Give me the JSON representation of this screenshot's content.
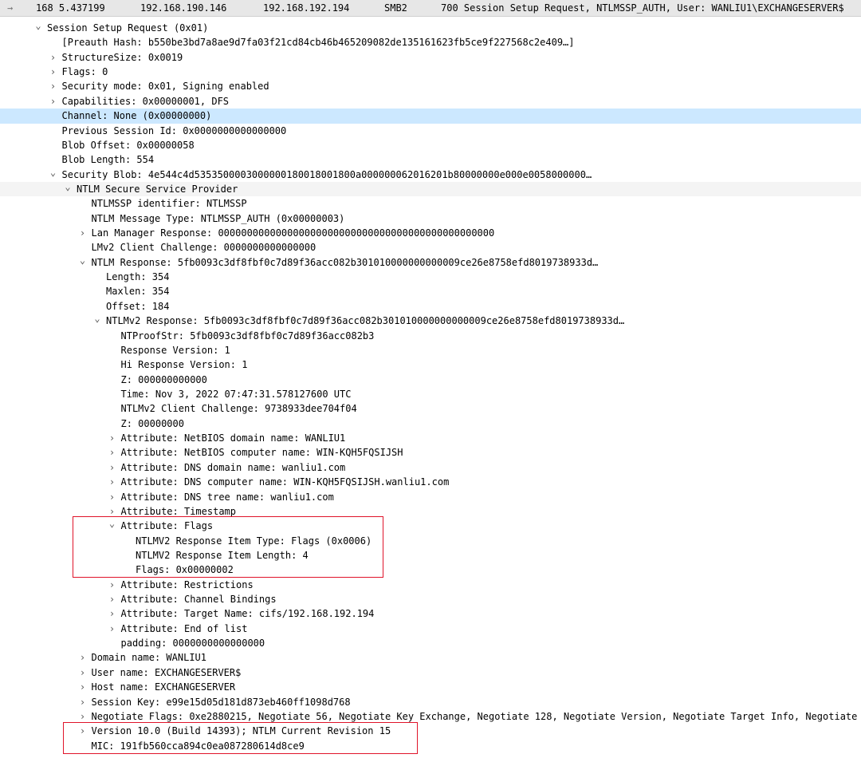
{
  "packet": {
    "arrow": "→",
    "number_time": "168 5.437199",
    "source": "192.168.190.146",
    "destination": "192.168.192.194",
    "protocol": "SMB2",
    "info": "700 Session Setup Request, NTLMSSP_AUTH, User: WANLIU1\\EXCHANGESERVER$"
  },
  "toggles": {
    "expanded": "⌄",
    "collapsed": "›"
  },
  "tree": [
    {
      "id": "session-setup-request",
      "depth": 0,
      "toggle": "expanded",
      "text": "Session Setup Request (0x01)"
    },
    {
      "id": "preauth-hash",
      "depth": 1,
      "toggle": "none",
      "text": "[Preauth Hash: b550be3bd7a8ae9d7fa03f21cd84cb46b465209082de135161623fb5ce9f227568c2e409…]"
    },
    {
      "id": "structure-size",
      "depth": 1,
      "toggle": "collapsed",
      "text": "StructureSize: 0x0019"
    },
    {
      "id": "flags",
      "depth": 1,
      "toggle": "collapsed",
      "text": "Flags: 0"
    },
    {
      "id": "security-mode",
      "depth": 1,
      "toggle": "collapsed",
      "text": "Security mode: 0x01, Signing enabled"
    },
    {
      "id": "capabilities",
      "depth": 1,
      "toggle": "collapsed",
      "text": "Capabilities: 0x00000001, DFS"
    },
    {
      "id": "channel",
      "depth": 1,
      "toggle": "none",
      "text": "Channel: None (0x00000000)",
      "selected": true
    },
    {
      "id": "previous-session-id",
      "depth": 1,
      "toggle": "none",
      "text": "Previous Session Id: 0x0000000000000000"
    },
    {
      "id": "blob-offset",
      "depth": 1,
      "toggle": "none",
      "text": "Blob Offset: 0x00000058"
    },
    {
      "id": "blob-length",
      "depth": 1,
      "toggle": "none",
      "text": "Blob Length: 554"
    },
    {
      "id": "security-blob",
      "depth": 1,
      "toggle": "expanded",
      "text": "Security Blob: 4e544c4d5353500003000000180018001800a000000062016201b80000000e000e0058000000…"
    },
    {
      "id": "ntlm-secure-service-provider",
      "depth": 2,
      "toggle": "expanded",
      "text": "NTLM Secure Service Provider",
      "hover": true
    },
    {
      "id": "ntlmssp-identifier",
      "depth": 3,
      "toggle": "none",
      "text": "NTLMSSP identifier: NTLMSSP"
    },
    {
      "id": "ntlm-message-type",
      "depth": 3,
      "toggle": "none",
      "text": "NTLM Message Type: NTLMSSP_AUTH (0x00000003)"
    },
    {
      "id": "lan-manager-response",
      "depth": 3,
      "toggle": "collapsed",
      "text": "Lan Manager Response: 000000000000000000000000000000000000000000000000"
    },
    {
      "id": "lmv2-client-challenge",
      "depth": 3,
      "toggle": "none",
      "text": "LMv2 Client Challenge: 0000000000000000"
    },
    {
      "id": "ntlm-response",
      "depth": 3,
      "toggle": "expanded",
      "text": "NTLM Response: 5fb0093c3df8fbf0c7d89f36acc082b301010000000000009ce26e8758efd8019738933d…"
    },
    {
      "id": "ntlm-response-length",
      "depth": 4,
      "toggle": "none",
      "text": "Length: 354"
    },
    {
      "id": "ntlm-response-maxlen",
      "depth": 4,
      "toggle": "none",
      "text": "Maxlen: 354"
    },
    {
      "id": "ntlm-response-offset",
      "depth": 4,
      "toggle": "none",
      "text": "Offset: 184"
    },
    {
      "id": "ntlmv2-response",
      "depth": 4,
      "toggle": "expanded",
      "text": "NTLMv2 Response: 5fb0093c3df8fbf0c7d89f36acc082b301010000000000009ce26e8758efd8019738933d…"
    },
    {
      "id": "ntproofstr",
      "depth": 5,
      "toggle": "none",
      "text": "NTProofStr: 5fb0093c3df8fbf0c7d89f36acc082b3"
    },
    {
      "id": "response-version",
      "depth": 5,
      "toggle": "none",
      "text": "Response Version: 1"
    },
    {
      "id": "hi-response-version",
      "depth": 5,
      "toggle": "none",
      "text": "Hi Response Version: 1"
    },
    {
      "id": "z-1",
      "depth": 5,
      "toggle": "none",
      "text": "Z: 000000000000"
    },
    {
      "id": "time",
      "depth": 5,
      "toggle": "none",
      "text": "Time: Nov  3, 2022 07:47:31.578127600 UTC"
    },
    {
      "id": "ntlmv2-client-challenge",
      "depth": 5,
      "toggle": "none",
      "text": "NTLMv2 Client Challenge: 9738933dee704f04"
    },
    {
      "id": "z-2",
      "depth": 5,
      "toggle": "none",
      "text": "Z: 00000000"
    },
    {
      "id": "attr-netbios-domain",
      "depth": 5,
      "toggle": "collapsed",
      "text": "Attribute: NetBIOS domain name: WANLIU1"
    },
    {
      "id": "attr-netbios-computer",
      "depth": 5,
      "toggle": "collapsed",
      "text": "Attribute: NetBIOS computer name: WIN-KQH5FQSIJSH"
    },
    {
      "id": "attr-dns-domain",
      "depth": 5,
      "toggle": "collapsed",
      "text": "Attribute: DNS domain name: wanliu1.com"
    },
    {
      "id": "attr-dns-computer",
      "depth": 5,
      "toggle": "collapsed",
      "text": "Attribute: DNS computer name: WIN-KQH5FQSIJSH.wanliu1.com"
    },
    {
      "id": "attr-dns-tree",
      "depth": 5,
      "toggle": "collapsed",
      "text": "Attribute: DNS tree name: wanliu1.com"
    },
    {
      "id": "attr-timestamp",
      "depth": 5,
      "toggle": "collapsed",
      "text": "Attribute: Timestamp"
    },
    {
      "id": "attr-flags",
      "depth": 5,
      "toggle": "expanded",
      "text": "Attribute: Flags"
    },
    {
      "id": "ntlmv2-item-type",
      "depth": 6,
      "toggle": "none",
      "text": "NTLMV2 Response Item Type: Flags (0x0006)"
    },
    {
      "id": "ntlmv2-item-length",
      "depth": 6,
      "toggle": "none",
      "text": "NTLMV2 Response Item Length: 4"
    },
    {
      "id": "attr-flags-value",
      "depth": 6,
      "toggle": "none",
      "text": "Flags: 0x00000002"
    },
    {
      "id": "attr-restrictions",
      "depth": 5,
      "toggle": "collapsed",
      "text": "Attribute: Restrictions"
    },
    {
      "id": "attr-channel-bindings",
      "depth": 5,
      "toggle": "collapsed",
      "text": "Attribute: Channel Bindings"
    },
    {
      "id": "attr-target-name",
      "depth": 5,
      "toggle": "collapsed",
      "text": "Attribute: Target Name: cifs/192.168.192.194"
    },
    {
      "id": "attr-end-of-list",
      "depth": 5,
      "toggle": "collapsed",
      "text": "Attribute: End of list"
    },
    {
      "id": "padding",
      "depth": 5,
      "toggle": "none",
      "text": "padding: 0000000000000000"
    },
    {
      "id": "domain-name",
      "depth": 3,
      "toggle": "collapsed",
      "text": "Domain name: WANLIU1"
    },
    {
      "id": "user-name",
      "depth": 3,
      "toggle": "collapsed",
      "text": "User name: EXCHANGESERVER$"
    },
    {
      "id": "host-name",
      "depth": 3,
      "toggle": "collapsed",
      "text": "Host name: EXCHANGESERVER"
    },
    {
      "id": "session-key",
      "depth": 3,
      "toggle": "collapsed",
      "text": "Session Key: e99e15d05d181d873eb460ff1098d768"
    },
    {
      "id": "negotiate-flags",
      "depth": 3,
      "toggle": "collapsed",
      "text": "Negotiate Flags: 0xe2880215, Negotiate 56, Negotiate Key Exchange, Negotiate 128, Negotiate Version, Negotiate Target Info, Negotiate Extended Security"
    },
    {
      "id": "version",
      "depth": 3,
      "toggle": "collapsed",
      "text": "Version 10.0 (Build 14393); NTLM Current Revision 15"
    },
    {
      "id": "mic",
      "depth": 3,
      "toggle": "none",
      "text": "MIC: 191fb560cca894c0ea087280614d8ce9"
    }
  ],
  "colors": {
    "selected_row": "#cce8ff",
    "packet_row": "#e7e7e7",
    "highlight_box": "#e0142a"
  }
}
